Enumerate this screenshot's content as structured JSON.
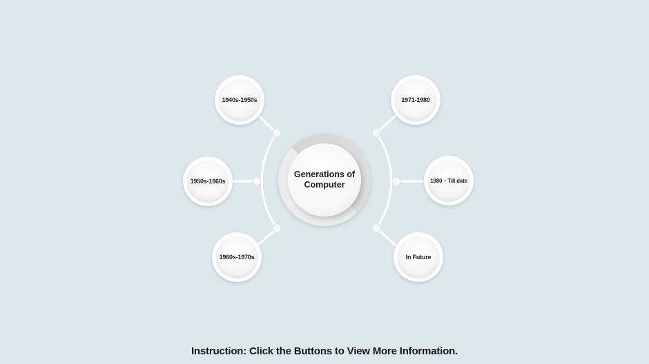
{
  "diagram": {
    "center": {
      "title": "Generations of Computer"
    },
    "left_nodes": [
      {
        "label": "1940s-1950s"
      },
      {
        "label": "1950s-1960s"
      },
      {
        "label": "1960s-1970s"
      }
    ],
    "right_nodes": [
      {
        "label": "1971-1980"
      },
      {
        "label": "1980 – Till date"
      },
      {
        "label": "In Future"
      }
    ]
  },
  "instruction": "Instruction: Click the Buttons to View More Information.",
  "colors": {
    "background": "#dde8ec",
    "connector": "#ffffff",
    "text": "#1e1e1e"
  }
}
